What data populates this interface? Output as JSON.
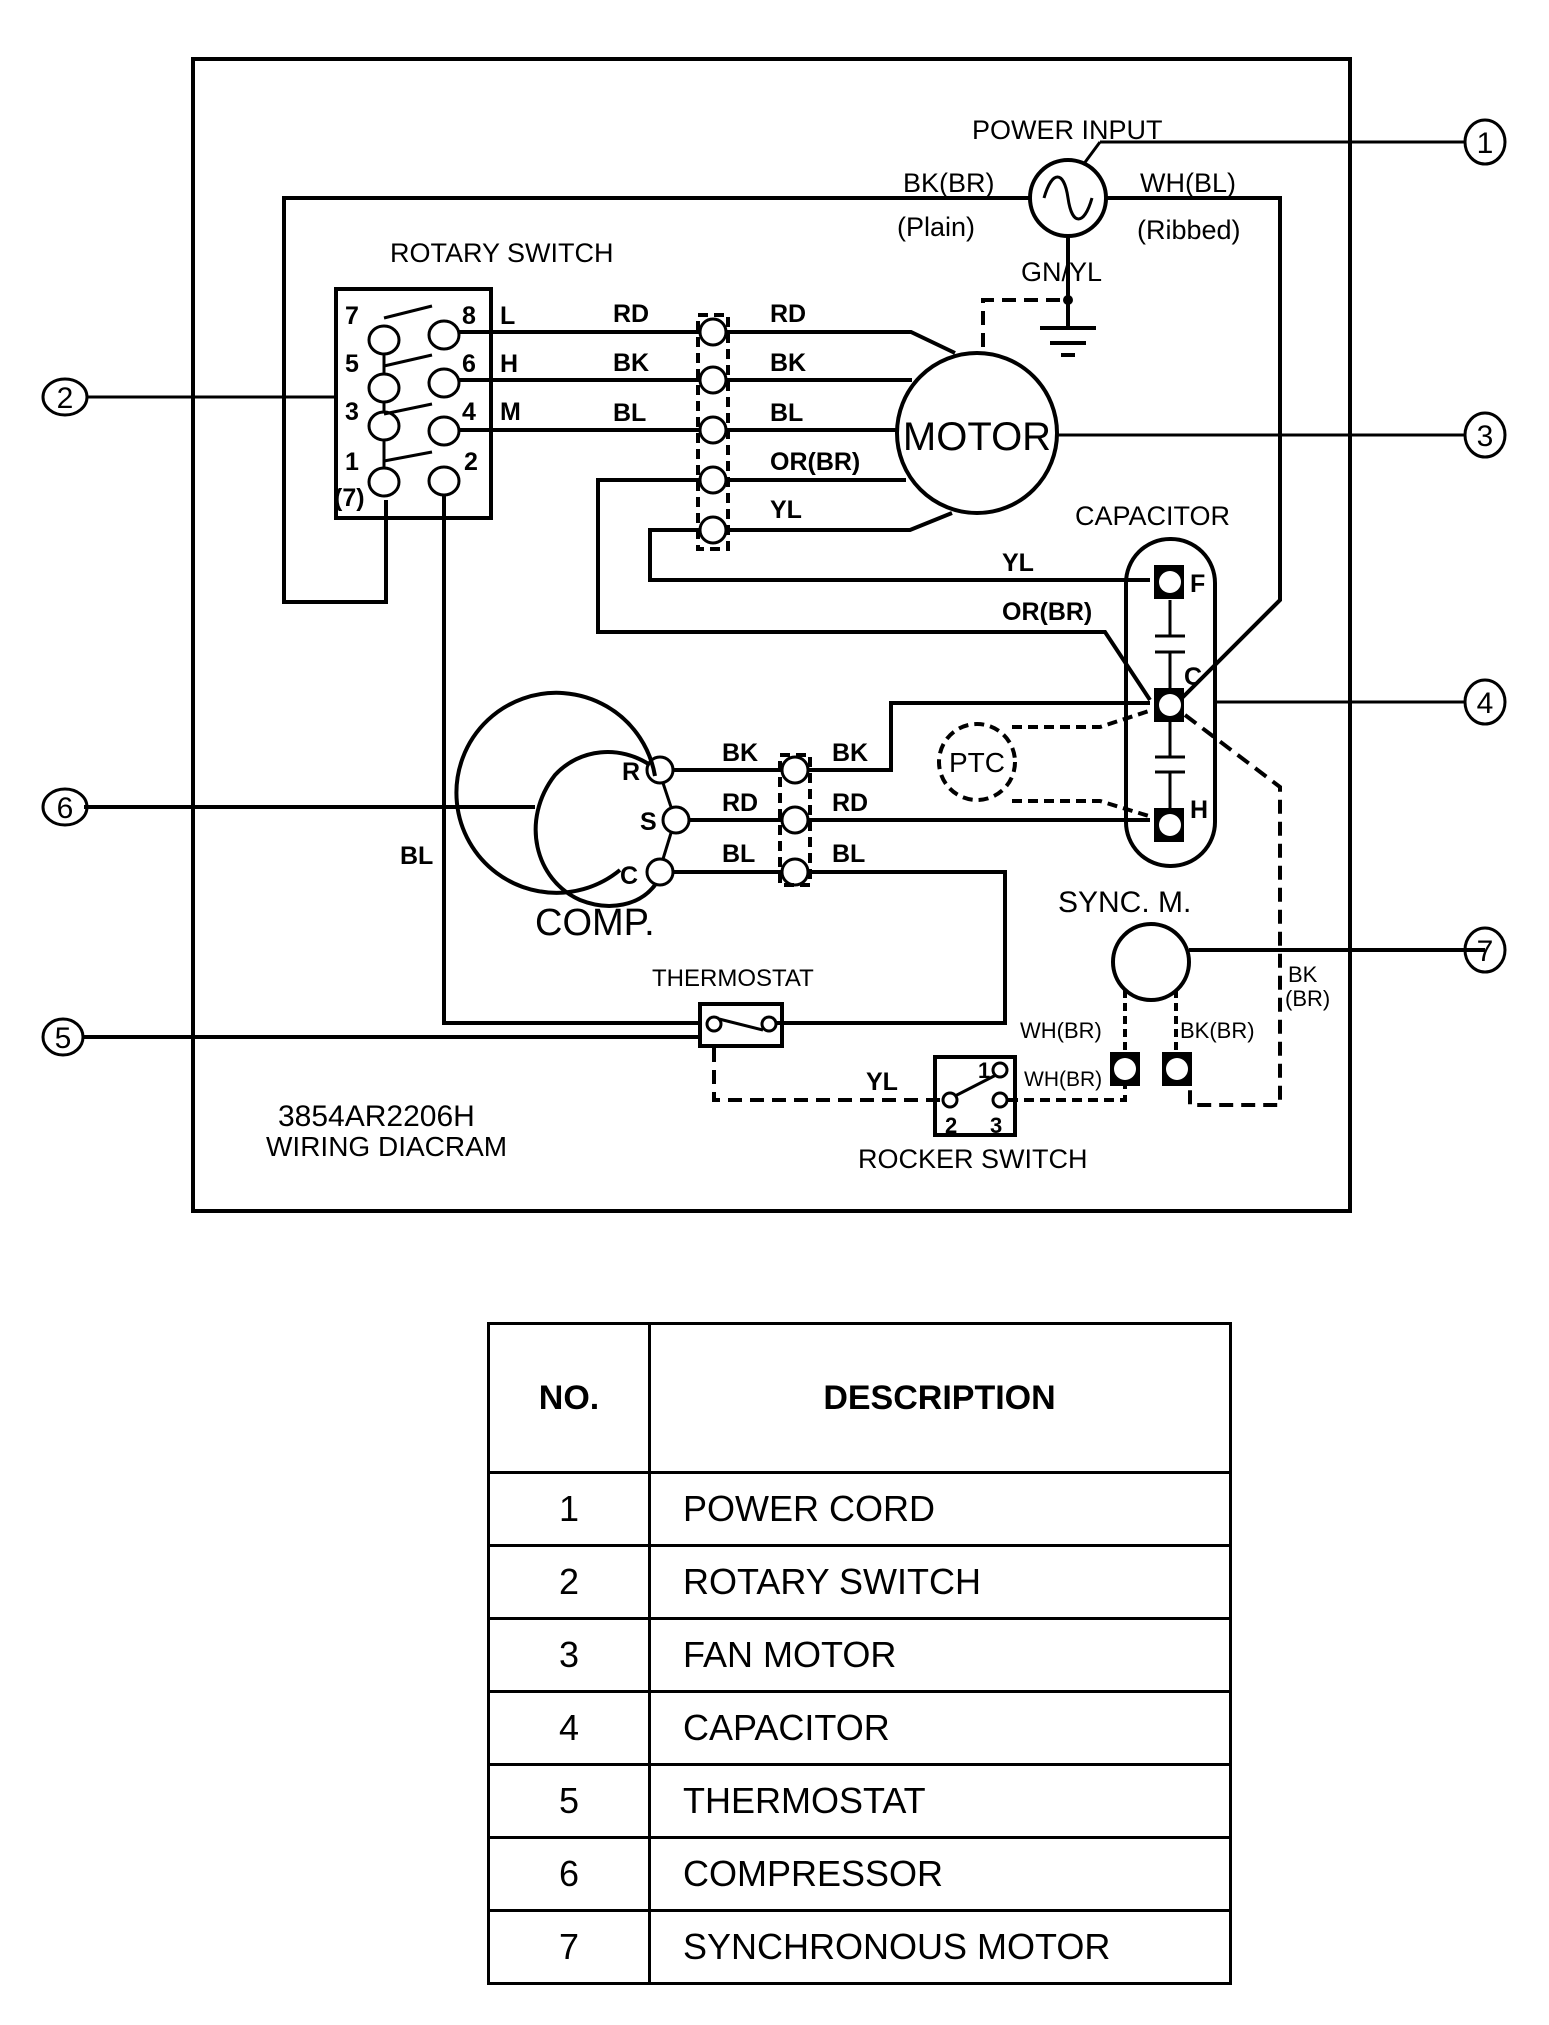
{
  "diagram": {
    "model": "3854AR2206H",
    "title": "WIRING DIACRAM",
    "components": {
      "power_input": "POWER INPUT",
      "rotary_switch": "ROTARY SWITCH",
      "motor": "MOTOR",
      "capacitor": "CAPACITOR",
      "ptc": "PTC",
      "compressor": "COMP.",
      "sync_motor": "SYNC. M.",
      "thermostat": "THERMOSTAT",
      "rocker_switch": "ROCKER SWITCH"
    },
    "power_wires": {
      "line": "BK(BR)",
      "line_note": "(Plain)",
      "neutral": "WH(BL)",
      "neutral_note": "(Ribbed)",
      "ground": "GN/YL"
    },
    "rotary_switch_terminals": {
      "left": [
        "7",
        "5",
        "3",
        "1",
        "(7)"
      ],
      "right": [
        "8",
        "6",
        "4",
        "2"
      ],
      "speeds": [
        "L",
        "H",
        "M"
      ]
    },
    "motor_wires_left": [
      "RD",
      "BK",
      "BL"
    ],
    "motor_wires_right": [
      "RD",
      "BK",
      "BL",
      "OR(BR)",
      "YL"
    ],
    "capacitor_wires": [
      "YL",
      "OR(BR)"
    ],
    "capacitor_terminals": [
      "F",
      "C",
      "H"
    ],
    "compressor_terminals": [
      "R",
      "S",
      "C"
    ],
    "compressor_wires_left": [
      "BK",
      "RD",
      "BL"
    ],
    "compressor_wires_right": [
      "BK",
      "RD",
      "BL"
    ],
    "thermostat_wire": "BL",
    "sync_motor_wires": [
      "WH(BR)",
      "BK(BR)",
      "BK",
      "(BR)"
    ],
    "rocker_switch_wires": [
      "YL",
      "WH(BR)"
    ],
    "rocker_switch_terminals": [
      "1",
      "2",
      "3"
    ],
    "callouts": [
      "1",
      "2",
      "3",
      "4",
      "5",
      "6",
      "7"
    ]
  },
  "legend": {
    "headers": [
      "NO.",
      "DESCRIPTION"
    ],
    "rows": [
      {
        "no": "1",
        "desc": "POWER CORD"
      },
      {
        "no": "2",
        "desc": "ROTARY SWITCH"
      },
      {
        "no": "3",
        "desc": "FAN MOTOR"
      },
      {
        "no": "4",
        "desc": "CAPACITOR"
      },
      {
        "no": "5",
        "desc": "THERMOSTAT"
      },
      {
        "no": "6",
        "desc": "COMPRESSOR"
      },
      {
        "no": "7",
        "desc": "SYNCHRONOUS MOTOR"
      }
    ]
  }
}
